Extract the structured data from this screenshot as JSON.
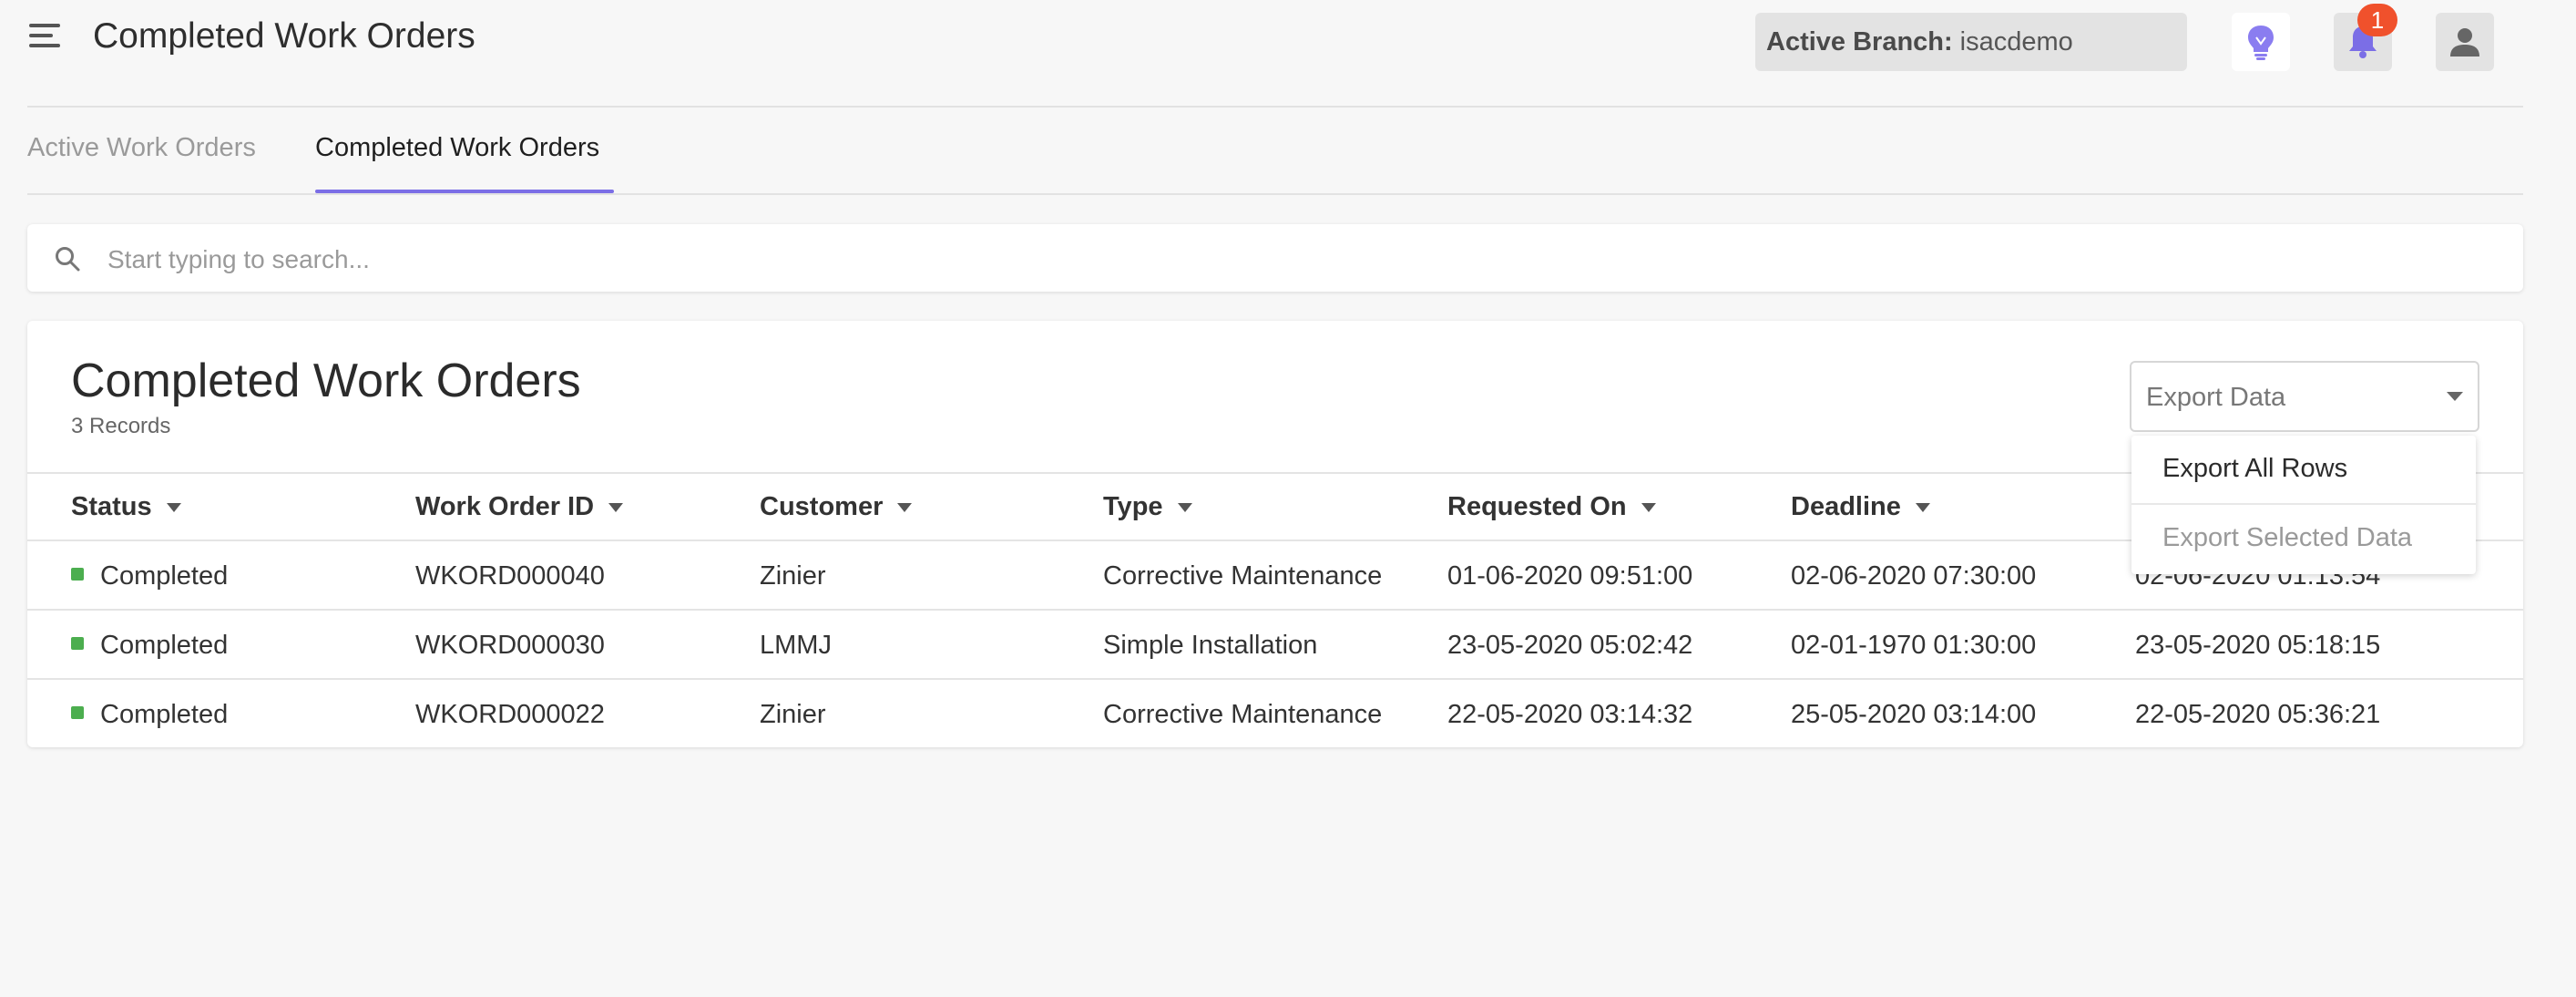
{
  "header": {
    "title": "Completed Work Orders",
    "branch_label": "Active Branch:",
    "branch_value": "isacdemo",
    "notification_count": "1"
  },
  "tabs": [
    {
      "label": "Active Work Orders",
      "active": false
    },
    {
      "label": "Completed Work Orders",
      "active": true
    }
  ],
  "search": {
    "placeholder": "Start typing to search...",
    "value": ""
  },
  "card": {
    "title": "Completed Work Orders",
    "record_count": "3 Records",
    "export_label": "Export Data",
    "export_options": [
      "Export All Rows",
      "Export Selected Data"
    ]
  },
  "table": {
    "columns": [
      "Status",
      "Work Order ID",
      "Customer",
      "Type",
      "Requested On",
      "Deadline"
    ],
    "rows": [
      [
        "Completed",
        "WKORD000040",
        "Zinier",
        "Corrective Maintenance",
        "01-06-2020 09:51:00",
        "02-06-2020 07:30:00",
        "02-06-2020 01:13:54"
      ],
      [
        "Completed",
        "WKORD000030",
        "LMMJ",
        "Simple Installation",
        "23-05-2020 05:02:42",
        "02-01-1970 01:30:00",
        "23-05-2020 05:18:15"
      ],
      [
        "Completed",
        "WKORD000022",
        "Zinier",
        "Corrective Maintenance",
        "22-05-2020 03:14:32",
        "25-05-2020 03:14:00",
        "22-05-2020 05:36:21"
      ]
    ]
  },
  "colors": {
    "accent": "#7b6ee6",
    "badge": "#f0512c",
    "status_completed": "#4cae4f"
  },
  "icons": [
    "menu-icon",
    "lightbulb-icon",
    "bell-icon",
    "user-icon",
    "search-icon",
    "chevron-down-icon"
  ]
}
